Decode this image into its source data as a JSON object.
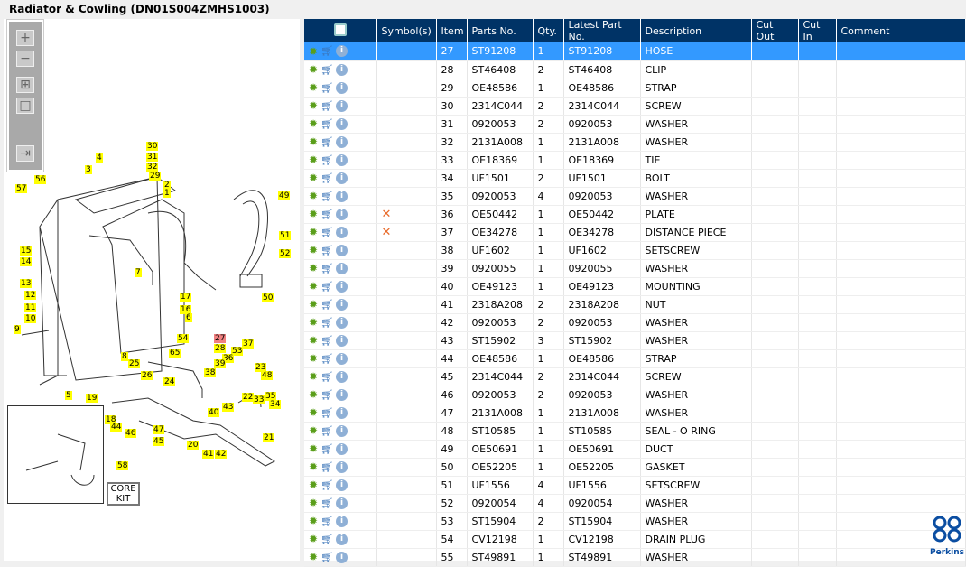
{
  "title": "Radiator & Cowling (DN01S004ZMHS1003)",
  "toolbar": {
    "zoom_in": "+",
    "zoom_out": "−",
    "fit": "⊞",
    "reset": "□",
    "toggle": "⇥"
  },
  "diagram": {
    "callouts": [
      "30",
      "31",
      "32",
      "4",
      "3",
      "29",
      "2",
      "1",
      "56",
      "57",
      "49",
      "15",
      "14",
      "51",
      "52",
      "7",
      "13",
      "17",
      "50",
      "12",
      "16",
      "11",
      "6",
      "10",
      "9",
      "54",
      "27",
      "28",
      "65",
      "53",
      "37",
      "8",
      "36",
      "25",
      "39",
      "23",
      "38",
      "48",
      "26",
      "24",
      "22",
      "33",
      "35",
      "5",
      "19",
      "34",
      "43",
      "40",
      "18",
      "21",
      "44",
      "47",
      "46",
      "45",
      "20",
      "41",
      "42",
      "58"
    ],
    "selected_callout": "27",
    "core_kit": [
      "CORE",
      "KIT"
    ]
  },
  "grid": {
    "columns": [
      "",
      "Symbol(s)",
      "Item",
      "Parts No.",
      "Qty.",
      "Latest Part No.",
      "Description",
      "Cut Out",
      "Cut In",
      "Comment"
    ],
    "selected_item": "27",
    "rows": [
      {
        "item": "27",
        "part": "ST91208",
        "qty": "1",
        "latest": "ST91208",
        "desc": "HOSE",
        "sym": ""
      },
      {
        "item": "28",
        "part": "ST46408",
        "qty": "2",
        "latest": "ST46408",
        "desc": "CLIP",
        "sym": ""
      },
      {
        "item": "29",
        "part": "OE48586",
        "qty": "1",
        "latest": "OE48586",
        "desc": "STRAP",
        "sym": ""
      },
      {
        "item": "30",
        "part": "2314C044",
        "qty": "2",
        "latest": "2314C044",
        "desc": "SCREW",
        "sym": ""
      },
      {
        "item": "31",
        "part": "0920053",
        "qty": "2",
        "latest": "0920053",
        "desc": "WASHER",
        "sym": ""
      },
      {
        "item": "32",
        "part": "2131A008",
        "qty": "1",
        "latest": "2131A008",
        "desc": "WASHER",
        "sym": ""
      },
      {
        "item": "33",
        "part": "OE18369",
        "qty": "1",
        "latest": "OE18369",
        "desc": "TIE",
        "sym": ""
      },
      {
        "item": "34",
        "part": "UF1501",
        "qty": "2",
        "latest": "UF1501",
        "desc": "BOLT",
        "sym": ""
      },
      {
        "item": "35",
        "part": "0920053",
        "qty": "4",
        "latest": "0920053",
        "desc": "WASHER",
        "sym": ""
      },
      {
        "item": "36",
        "part": "OE50442",
        "qty": "1",
        "latest": "OE50442",
        "desc": "PLATE",
        "sym": "✕"
      },
      {
        "item": "37",
        "part": "OE34278",
        "qty": "1",
        "latest": "OE34278",
        "desc": "DISTANCE PIECE",
        "sym": "✕"
      },
      {
        "item": "38",
        "part": "UF1602",
        "qty": "1",
        "latest": "UF1602",
        "desc": "SETSCREW",
        "sym": ""
      },
      {
        "item": "39",
        "part": "0920055",
        "qty": "1",
        "latest": "0920055",
        "desc": "WASHER",
        "sym": ""
      },
      {
        "item": "40",
        "part": "OE49123",
        "qty": "1",
        "latest": "OE49123",
        "desc": "MOUNTING",
        "sym": ""
      },
      {
        "item": "41",
        "part": "2318A208",
        "qty": "2",
        "latest": "2318A208",
        "desc": "NUT",
        "sym": ""
      },
      {
        "item": "42",
        "part": "0920053",
        "qty": "2",
        "latest": "0920053",
        "desc": "WASHER",
        "sym": ""
      },
      {
        "item": "43",
        "part": "ST15902",
        "qty": "3",
        "latest": "ST15902",
        "desc": "WASHER",
        "sym": ""
      },
      {
        "item": "44",
        "part": "OE48586",
        "qty": "1",
        "latest": "OE48586",
        "desc": "STRAP",
        "sym": ""
      },
      {
        "item": "45",
        "part": "2314C044",
        "qty": "2",
        "latest": "2314C044",
        "desc": "SCREW",
        "sym": ""
      },
      {
        "item": "46",
        "part": "0920053",
        "qty": "2",
        "latest": "0920053",
        "desc": "WASHER",
        "sym": ""
      },
      {
        "item": "47",
        "part": "2131A008",
        "qty": "1",
        "latest": "2131A008",
        "desc": "WASHER",
        "sym": ""
      },
      {
        "item": "48",
        "part": "ST10585",
        "qty": "1",
        "latest": "ST10585",
        "desc": "SEAL - O RING",
        "sym": ""
      },
      {
        "item": "49",
        "part": "OE50691",
        "qty": "1",
        "latest": "OE50691",
        "desc": "DUCT",
        "sym": ""
      },
      {
        "item": "50",
        "part": "OE52205",
        "qty": "1",
        "latest": "OE52205",
        "desc": "GASKET",
        "sym": ""
      },
      {
        "item": "51",
        "part": "UF1556",
        "qty": "4",
        "latest": "UF1556",
        "desc": "SETSCREW",
        "sym": ""
      },
      {
        "item": "52",
        "part": "0920054",
        "qty": "4",
        "latest": "0920054",
        "desc": "WASHER",
        "sym": ""
      },
      {
        "item": "53",
        "part": "ST15904",
        "qty": "2",
        "latest": "ST15904",
        "desc": "WASHER",
        "sym": ""
      },
      {
        "item": "54",
        "part": "CV12198",
        "qty": "1",
        "latest": "CV12198",
        "desc": "DRAIN PLUG",
        "sym": ""
      },
      {
        "item": "55",
        "part": "ST49891",
        "qty": "1",
        "latest": "ST49891",
        "desc": "WASHER",
        "sym": ""
      }
    ]
  },
  "logo": {
    "text": "Perkins"
  },
  "colors": {
    "header": "#003366",
    "selected": "#3399ff",
    "callout": "#ffff00"
  }
}
